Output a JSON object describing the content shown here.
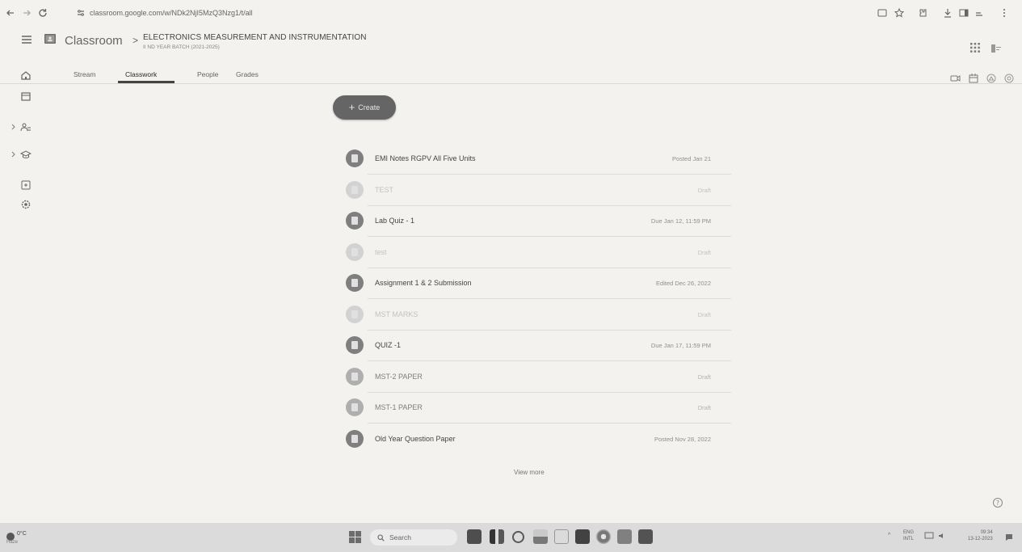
{
  "browser": {
    "url": "classroom.google.com/w/NDk2NjI5MzQ3Nzg1/t/all"
  },
  "header": {
    "brand": "Classroom",
    "separator": ">",
    "course_title": "ELECTRONICS MEASUREMENT AND INSTRUMENTATION",
    "course_subtitle": "II ND YEAR BATCH (2021-2025)"
  },
  "tabs": [
    {
      "label": "Stream"
    },
    {
      "label": "Classwork"
    },
    {
      "label": "People"
    },
    {
      "label": "Grades"
    }
  ],
  "active_tab": "Classwork",
  "create_button": {
    "label": "Create",
    "icon": "plus-icon"
  },
  "classwork": [
    {
      "title": "EMI Notes RGPV All Five Units",
      "meta": "Posted Jan 21",
      "state": "normal"
    },
    {
      "title": "TEST",
      "meta": "Draft",
      "state": "faint"
    },
    {
      "title": "Lab Quiz - 1",
      "meta": "Due Jan 12, 11:59 PM",
      "state": "normal"
    },
    {
      "title": "test",
      "meta": "Draft",
      "state": "faint"
    },
    {
      "title": "Assignment 1 & 2 Submission",
      "meta": "Edited Dec 26, 2022",
      "state": "normal"
    },
    {
      "title": "MST MARKS",
      "meta": "Draft",
      "state": "faint"
    },
    {
      "title": "QUIZ -1",
      "meta": "Due Jan 17, 11:59 PM",
      "state": "normal"
    },
    {
      "title": "MST-2 PAPER",
      "meta": "Draft",
      "state": "light"
    },
    {
      "title": "MST-1 PAPER",
      "meta": "Draft",
      "state": "light"
    },
    {
      "title": "Old Year Question Paper",
      "meta": "Posted Nov 28, 2022",
      "state": "normal"
    }
  ],
  "view_more": "View more",
  "taskbar": {
    "weather_temp": "0°C",
    "weather_desc": "Haze",
    "search_label": "Search",
    "tray_arrow": "^",
    "lang_line1": "ENG",
    "lang_line2": "INTL",
    "time": "09:34",
    "date": "13-12-2023"
  }
}
